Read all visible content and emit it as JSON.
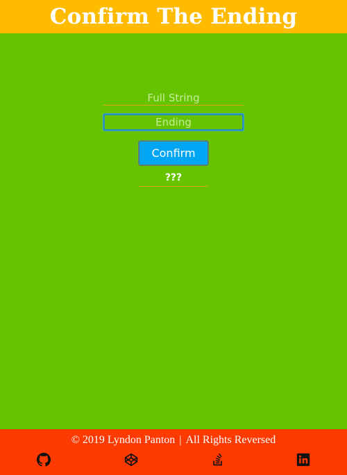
{
  "header": {
    "title": "Confirm The Ending"
  },
  "form": {
    "full_string_placeholder": "Full String",
    "ending_placeholder": "Ending",
    "confirm_label": "Confirm",
    "result_text": "???"
  },
  "footer": {
    "copyright": "© 2019 Lyndon Panton",
    "separator": "|",
    "rights": "All Rights Reversed",
    "social": [
      {
        "icon": "github-icon"
      },
      {
        "icon": "codepen-icon"
      },
      {
        "icon": "stackoverflow-icon"
      },
      {
        "icon": "linkedin-icon"
      }
    ]
  },
  "colors": {
    "header_bg": "#ffbb00",
    "page_bg": "#66c300",
    "footer_bg": "#ff3a00",
    "button_bg": "#00a6f3",
    "accent_line": "#e0a41a"
  }
}
